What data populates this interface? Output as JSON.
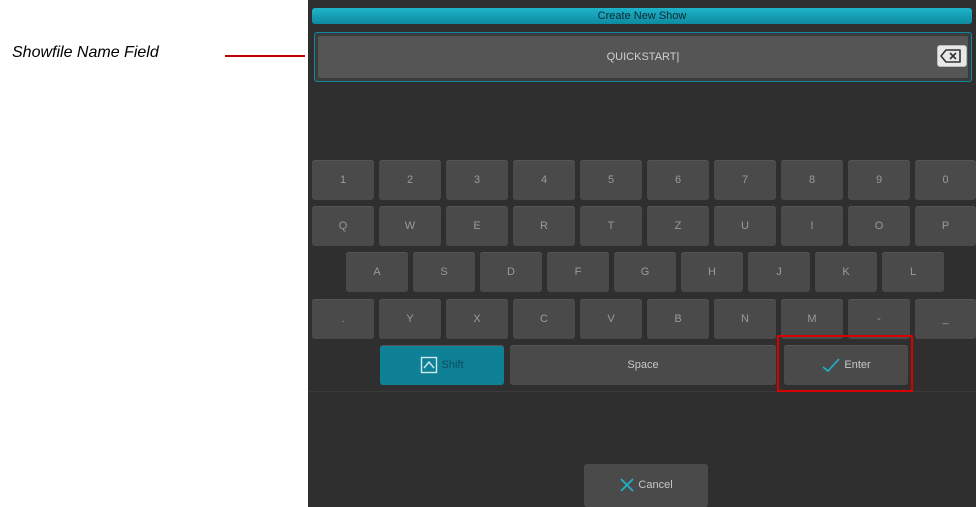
{
  "annotations": {
    "name_field_label": "Showfile Name Field"
  },
  "dialog": {
    "title": "Create New Show",
    "name_field_value": "QUICKSTART"
  },
  "keyboard": {
    "row1": [
      "1",
      "2",
      "3",
      "4",
      "5",
      "6",
      "7",
      "8",
      "9",
      "0"
    ],
    "row2": [
      "Q",
      "W",
      "E",
      "R",
      "T",
      "Z",
      "U",
      "I",
      "O",
      "P"
    ],
    "row3": [
      "A",
      "S",
      "D",
      "F",
      "G",
      "H",
      "J",
      "K",
      "L"
    ],
    "row4": [
      ".",
      "Y",
      "X",
      "C",
      "V",
      "B",
      "N",
      "M",
      "-",
      "_"
    ],
    "shift_label": "Shift",
    "space_label": "Space",
    "enter_label": "Enter"
  },
  "footer": {
    "cancel_label": "Cancel"
  },
  "icons": {
    "backspace": "backspace-icon",
    "shift": "shift-icon",
    "enter": "checkmark-icon",
    "cancel": "close-icon"
  },
  "colors": {
    "accent": "#0f8197",
    "highlight": "#d90000",
    "background": "#2f2f2f"
  }
}
